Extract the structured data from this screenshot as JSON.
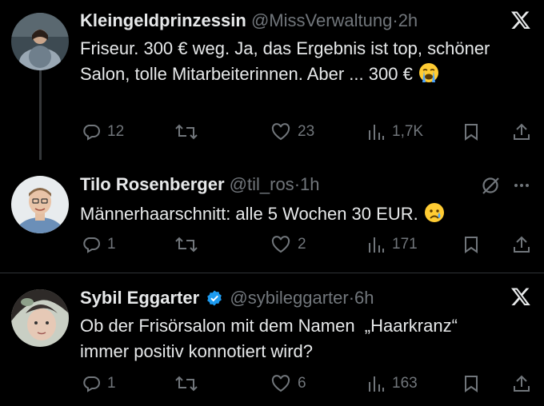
{
  "tweets": [
    {
      "name": "Kleingeldprinzessin",
      "handle": "@MissVerwaltung",
      "dot": "·",
      "time": "2h",
      "text": "Friseur. 300 € weg. Ja, das Ergebnis ist top, schöner Salon, tolle Mitarbeiterinnen. Aber ... 300 €",
      "emoji": "loudly-crying-face",
      "top_icon": "x-logo-icon",
      "replies": "12",
      "retweets": "",
      "likes": "23",
      "views": "1,7K"
    },
    {
      "name": "Tilo Rosenberger",
      "handle": "@til_ros",
      "dot": "·",
      "time": "1h",
      "text": "Männerhaarschnitt: alle 5 Wochen 30 EUR.",
      "emoji": "crying-face",
      "top_icon": "grok-icon",
      "replies": "1",
      "retweets": "",
      "likes": "2",
      "views": "171"
    },
    {
      "name": "Sybil Eggarter",
      "handle": "@sybileggarter",
      "dot": "·",
      "time": "6h",
      "text_line1": "Ob der Frisörsalon mit dem Namen  „Haarkranz“",
      "text_line2": "immer positiv konnotiert wird?",
      "verified": true,
      "top_icon": "x-logo-icon",
      "replies": "1",
      "retweets": "",
      "likes": "6",
      "views": "163"
    }
  ],
  "colors": {
    "background": "#000000",
    "text": "#e7e9ea",
    "secondary": "#71767b",
    "verified": "#1d9bf0",
    "divider": "#2f3336"
  }
}
